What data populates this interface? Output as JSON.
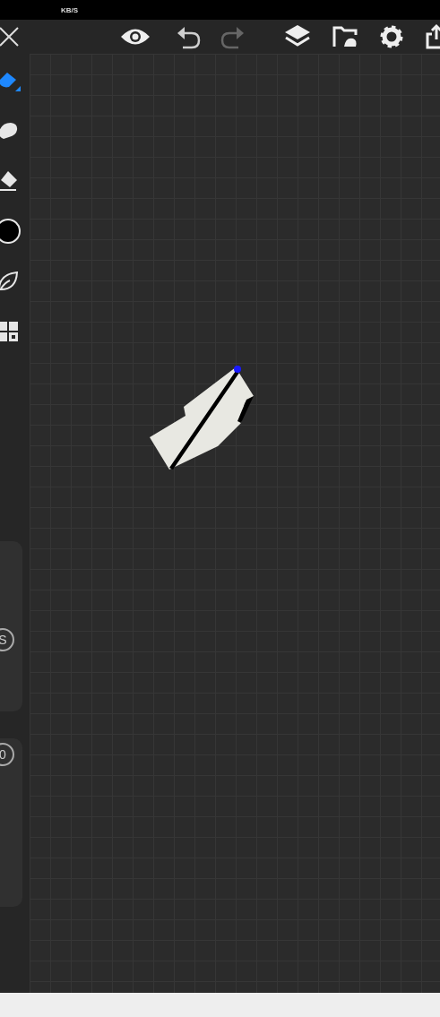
{
  "status_bar": {
    "speed": "KB/S"
  },
  "toolbar": {
    "undo_disabled": false,
    "redo_disabled": true
  },
  "tools": [
    {
      "kind": "pen",
      "selected": true
    },
    {
      "kind": "smudge",
      "selected": false
    },
    {
      "kind": "eraser",
      "selected": false
    },
    {
      "kind": "color",
      "selected": false,
      "color": "#000000"
    },
    {
      "kind": "leaf",
      "selected": false
    },
    {
      "kind": "grid",
      "selected": false
    }
  ],
  "sliders": [
    {
      "label": "S"
    },
    {
      "label": "0"
    }
  ]
}
